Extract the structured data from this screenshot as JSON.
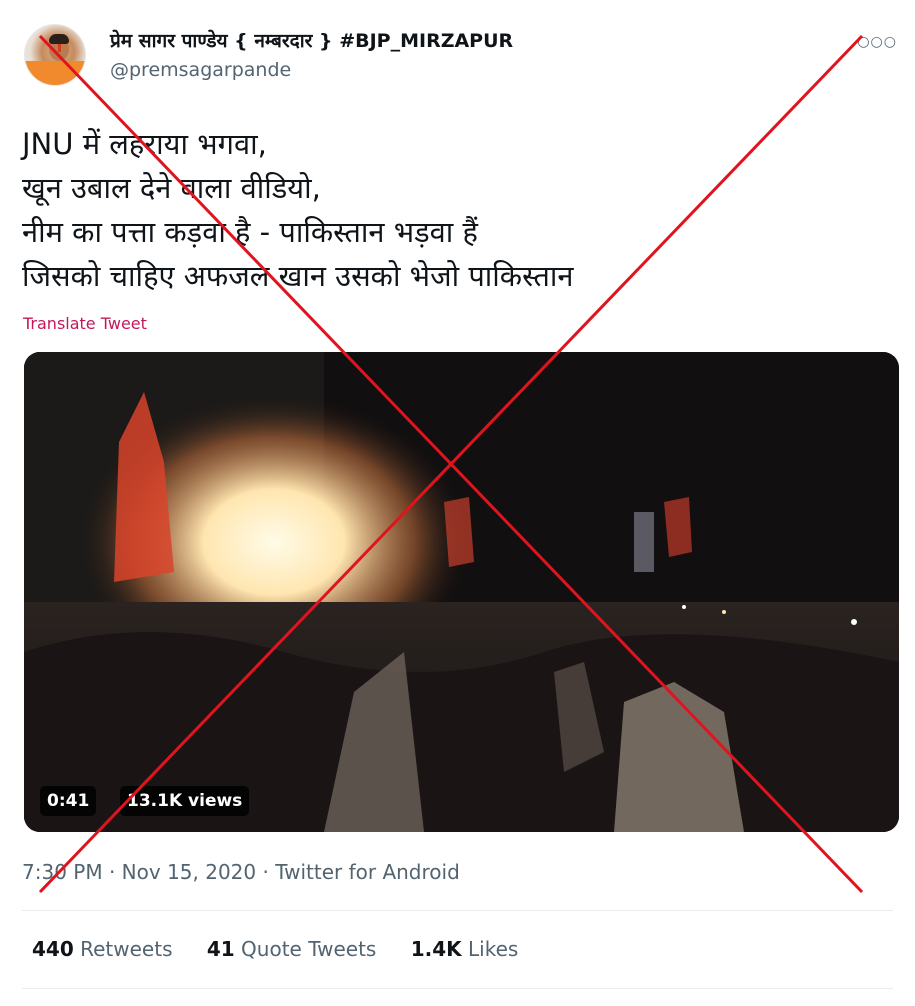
{
  "user": {
    "display_name": "प्रेम सागर पाण्डेय { नम्बरदार } #BJP_MIRZAPUR",
    "handle": "@premsagarpande",
    "avatar_icon": "profile-avatar"
  },
  "menu": {
    "icon": "more-options-icon",
    "glyph": "○○○"
  },
  "tweet": {
    "lines": [
      "JNU में लहराया भगवा,",
      "खून उबाल देने वाला वीडियो,",
      "नीम का पत्ता कड़वा है - पाकिस्तान भड़वा हैं",
      "जिसको चाहिए अफजल खान उसको भेजो पाकिस्तान"
    ],
    "translate_label": "Translate Tweet"
  },
  "video": {
    "duration": "0:41",
    "views": "13.1K views"
  },
  "meta": {
    "time": "7:30 PM",
    "separator": "·",
    "date": "Nov 15, 2020",
    "source": "Twitter for Android"
  },
  "stats": {
    "retweets_count": "440",
    "retweets_label": "Retweets",
    "quotes_count": "41",
    "quotes_label": "Quote Tweets",
    "likes_count": "1.4K",
    "likes_label": "Likes"
  },
  "colors": {
    "translate_link": "#c2185b",
    "cross_mark": "#e0141e"
  }
}
